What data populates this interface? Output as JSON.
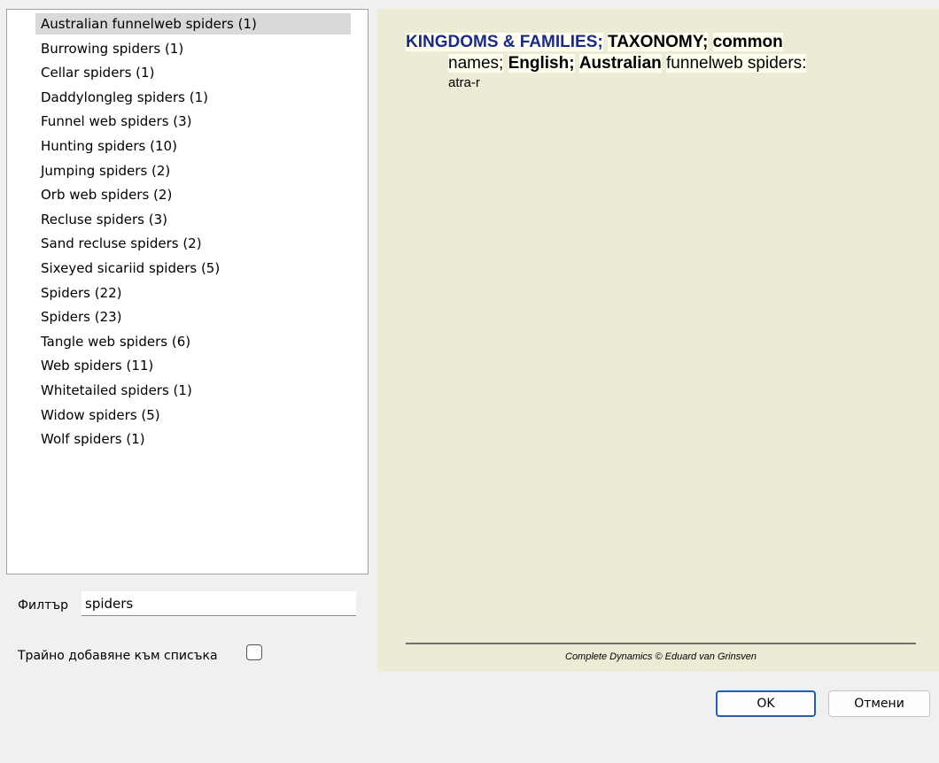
{
  "list": {
    "items": [
      "Australian funnelweb spiders (1)",
      "Burrowing spiders (1)",
      "Cellar spiders (1)",
      "Daddylongleg spiders (1)",
      "Funnel web spiders (3)",
      "Hunting spiders (10)",
      "Jumping spiders (2)",
      "Orb web spiders (2)",
      "Recluse spiders (3)",
      "Sand recluse spiders (2)",
      "Sixeyed sicariid spiders (5)",
      "Spiders (22)",
      "Spiders (23)",
      "Tangle web spiders (6)",
      "Web spiders (11)",
      "Whitetailed spiders (1)",
      "Widow spiders (5)",
      "Wolf spiders (1)"
    ],
    "selected_index": 0
  },
  "filter": {
    "label": "Филтър",
    "value": "spiders"
  },
  "persist": {
    "label": "Трайно добавяне към списъка",
    "checked": false
  },
  "preview": {
    "chapter": "KINGDOMS & FAMILIES;",
    "path_1": "TAXONOMY;",
    "path_2": "common",
    "path_3": "names;",
    "path_4": "English;",
    "path_5": "Australian",
    "path_6": "funnelweb spiders:",
    "remedy": "atra-r",
    "copyright": "Complete Dynamics © Eduard van Grinsven"
  },
  "buttons": {
    "ok": "OK",
    "cancel": "Отмени"
  },
  "colors": {
    "preview_bg": "#ebebd6",
    "chapter": "#1a2a8c",
    "selected": "#d9d9d9",
    "ok_border": "#1f5fb4"
  }
}
